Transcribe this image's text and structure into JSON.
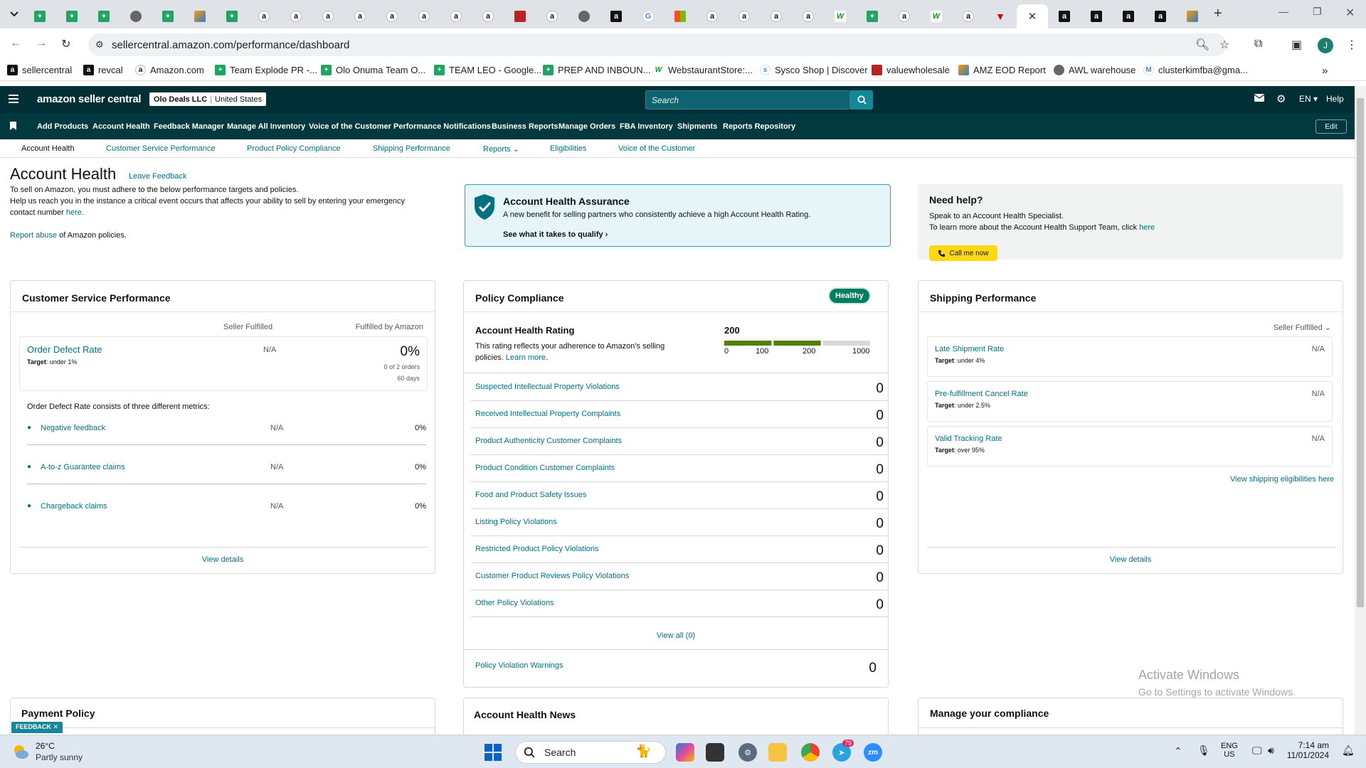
{
  "browser": {
    "url": "sellercentral.amazon.com/performance/dashboard",
    "tabs": [
      "sheet",
      "sheet",
      "sheet",
      "globe",
      "sheet",
      "pen",
      "sheet",
      "amz",
      "amz",
      "amz",
      "amz",
      "amz",
      "amz",
      "amz",
      "amz",
      "redbox",
      "amz",
      "globe",
      "amzbox",
      "g",
      "ms",
      "amz",
      "amz",
      "amz",
      "amz",
      "w",
      "sheet",
      "amz",
      "w",
      "amz",
      "tri",
      "active",
      "amzbox",
      "amzbox",
      "amzbox",
      "amzbox",
      "pen"
    ],
    "bookmarks": [
      {
        "label": "sellercentral",
        "icon": "amzbox"
      },
      {
        "label": "revcal",
        "icon": "amzbox"
      },
      {
        "label": "Amazon.com",
        "icon": "amz"
      },
      {
        "label": "Team Explode PR -...",
        "icon": "sheet"
      },
      {
        "label": "Olo Onuma Team O...",
        "icon": "sheet"
      },
      {
        "label": "TEAM LEO - Google...",
        "icon": "sheet"
      },
      {
        "label": "PREP AND INBOUN...",
        "icon": "sheet"
      },
      {
        "label": "WebstaurantStore:...",
        "icon": "w"
      },
      {
        "label": "Sysco Shop | Discover",
        "icon": "sysco"
      },
      {
        "label": "valuewholesale",
        "icon": "redbox"
      },
      {
        "label": "AMZ EOD Report",
        "icon": "pen"
      },
      {
        "label": "AWL warehouse",
        "icon": "globe"
      },
      {
        "label": "clusterkimfba@gma...",
        "icon": "gmail"
      }
    ],
    "avatar_letter": "J"
  },
  "header": {
    "logo": "amazon seller central",
    "account_name": "Olo Deals LLC",
    "account_region": "United States",
    "search_placeholder": "Search",
    "lang": "EN",
    "help": "Help",
    "nav": [
      "Add Products",
      "Account Health",
      "Feedback Manager",
      "Manage All Inventory",
      "Voice of the Customer",
      "Performance Notifications",
      "Business Reports",
      "Manage Orders",
      "FBA Inventory",
      "Shipments",
      "Reports Repository"
    ],
    "edit": "Edit"
  },
  "subnav": [
    "Account Health",
    "Customer Service Performance",
    "Product Policy Compliance",
    "Shipping Performance",
    "Reports",
    "Eligibilities",
    "Voice of the Customer"
  ],
  "page": {
    "title": "Account Health",
    "leave_feedback": "Leave Feedback",
    "intro1": "To sell on Amazon, you must adhere to the below performance targets and policies.",
    "intro2": "Help us reach you in the instance a critical event occurs that affects your ability to sell by entering your emergency",
    "intro3a": "contact number ",
    "intro3b": "here.",
    "report_abuse": "Report abuse",
    "report_abuse_rest": " of Amazon policies."
  },
  "assurance": {
    "title": "Account Health Assurance",
    "desc": "A new benefit for selling partners who consistently achieve a high Account Health Rating.",
    "link": "See what it takes to qualify"
  },
  "help": {
    "title": "Need help?",
    "line1": "Speak to an Account Health Specialist.",
    "line2": "To learn more about the Account Health Support Team, click ",
    "line2_link": "here",
    "call": "Call me now"
  },
  "csp": {
    "title": "Customer Service Performance",
    "col1": "Seller Fulfilled",
    "col2": "Fulfilled by Amazon",
    "odr_label": "Order Defect Rate",
    "odr_target_label": "Target",
    "odr_target": ": under 1%",
    "odr_sf": "N/A",
    "odr_fba": "0%",
    "odr_orders": "0 of 2 orders",
    "odr_days": "60 days",
    "consists": "Order Defect Rate consists of three different metrics:",
    "metrics": [
      {
        "name": "Negative feedback",
        "sf": "N/A",
        "fba": "0%"
      },
      {
        "name": "A-to-z Guarantee claims",
        "sf": "N/A",
        "fba": "0%"
      },
      {
        "name": "Chargeback claims",
        "sf": "N/A",
        "fba": "0%"
      }
    ],
    "view_details": "View details"
  },
  "policy": {
    "title": "Policy Compliance",
    "status": "Healthy",
    "ahr_title": "Account Health Rating",
    "ahr_desc1": "This rating reflects your adherence to Amazon's selling",
    "ahr_desc2": "policies. ",
    "learn_more": "Learn more.",
    "rating": "200",
    "rating_value": 200,
    "scale": [
      "0",
      "100",
      "200",
      "1000"
    ],
    "rows": [
      {
        "name": "Suspected Intellectual Property Violations",
        "count": "0"
      },
      {
        "name": "Received Intellectual Property Complaints",
        "count": "0"
      },
      {
        "name": "Product Authenticity Customer Complaints",
        "count": "0"
      },
      {
        "name": "Product Condition Customer Complaints",
        "count": "0"
      },
      {
        "name": "Food and Product Safety Issues",
        "count": "0"
      },
      {
        "name": "Listing Policy Violations",
        "count": "0"
      },
      {
        "name": "Restricted Product Policy Violations",
        "count": "0"
      },
      {
        "name": "Customer Product Reviews Policy Violations",
        "count": "0"
      },
      {
        "name": "Other Policy Violations",
        "count": "0"
      }
    ],
    "view_all": "View all (0)",
    "warnings": "Policy Violation Warnings",
    "warnings_count": "0"
  },
  "shipping": {
    "title": "Shipping Performance",
    "filter": "Seller Fulfilled",
    "metrics": [
      {
        "name": "Late Shipment Rate",
        "target_label": "Target",
        "target": ": under 4%",
        "value": "N/A"
      },
      {
        "name": "Pre-fulfillment Cancel Rate",
        "target_label": "Target",
        "target": ": under 2.5%",
        "value": "N/A"
      },
      {
        "name": "Valid Tracking Rate",
        "target_label": "Target",
        "target": ": over 95%",
        "value": "N/A"
      }
    ],
    "eligibilities": "View shipping eligibilities here",
    "view_details": "View details"
  },
  "bottom_cards": {
    "payment": "Payment Policy",
    "news": "Account Health News",
    "manage": "Manage your compliance"
  },
  "feedback_tab": "FEEDBACK",
  "watermark": {
    "line1": "Activate Windows",
    "line2": "Go to Settings to activate Windows."
  },
  "taskbar": {
    "temp": "26°C",
    "weather": "Partly sunny",
    "search": "Search",
    "lang1": "ENG",
    "lang2": "US",
    "time": "7:14 am",
    "date": "11/01/2024",
    "telegram_badge": "79"
  }
}
